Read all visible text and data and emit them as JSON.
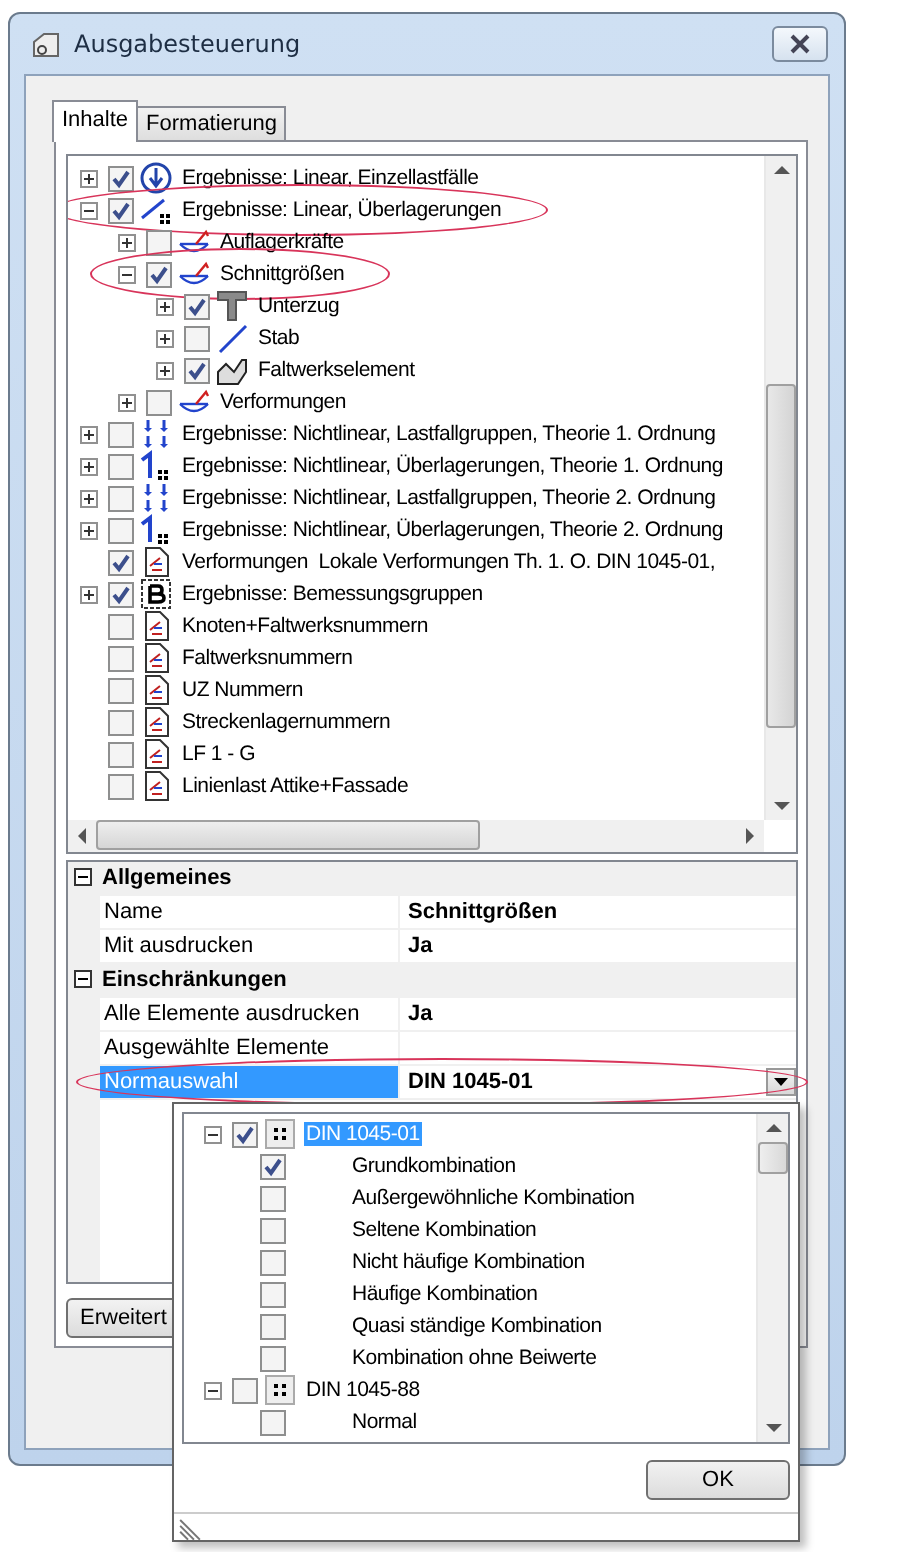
{
  "window": {
    "title": "Ausgabesteuerung"
  },
  "tabs": [
    {
      "label": "Inhalte",
      "selected": true
    },
    {
      "label": "Formatierung",
      "selected": false
    }
  ],
  "tree": {
    "items": [
      {
        "label": "Ergebnisse: Linear, Einzellastfälle",
        "kind": "load-cases",
        "checked": true,
        "expanded": false,
        "circled": false
      },
      {
        "label": "Ergebnisse: Linear, Überlagerungen",
        "kind": "superposition",
        "checked": true,
        "expanded": true,
        "circled": true,
        "children": [
          {
            "label": "Auflagerkräfte",
            "kind": "result",
            "checked": false,
            "expanded": false,
            "circled": false
          },
          {
            "label": "Schnittgrößen",
            "kind": "result",
            "checked": true,
            "expanded": true,
            "circled": true,
            "children": [
              {
                "label": "Unterzug",
                "kind": "t-beam",
                "checked": true,
                "expanded": false,
                "circled": false
              },
              {
                "label": "Stab",
                "kind": "bar",
                "checked": false,
                "expanded": false,
                "circled": false
              },
              {
                "label": "Faltwerkselement",
                "kind": "shell",
                "checked": true,
                "expanded": false,
                "circled": false
              }
            ]
          },
          {
            "label": "Verformungen",
            "kind": "result",
            "checked": false,
            "expanded": false,
            "circled": false
          }
        ]
      },
      {
        "label": "Ergebnisse: Nichtlinear, Lastfallgruppen, Theorie 1. Ordnung",
        "kind": "load-groups",
        "checked": false,
        "expanded": false,
        "circled": false
      },
      {
        "label": "Ergebnisse: Nichtlinear, Überlagerungen, Theorie 1. Ordnung",
        "kind": "nonlinear",
        "checked": false,
        "expanded": false,
        "circled": false
      },
      {
        "label": "Ergebnisse: Nichtlinear, Lastfallgruppen, Theorie 2. Ordnung",
        "kind": "load-groups",
        "checked": false,
        "expanded": false,
        "circled": false
      },
      {
        "label": "Ergebnisse: Nichtlinear, Überlagerungen, Theorie 2. Ordnung",
        "kind": "nonlinear",
        "checked": false,
        "expanded": false,
        "circled": false
      },
      {
        "label": "Verformungen  Lokale Verformungen Th. 1. O. DIN 1045-01,",
        "kind": "document",
        "checked": true,
        "circled": false
      },
      {
        "label": "Ergebnisse: Bemessungsgruppen",
        "kind": "design",
        "checked": true,
        "expanded": false,
        "circled": false
      },
      {
        "label": "Knoten+Faltwerksnummern",
        "kind": "document",
        "checked": false,
        "circled": false
      },
      {
        "label": "Faltwerksnummern",
        "kind": "document",
        "checked": false,
        "circled": false
      },
      {
        "label": "UZ Nummern",
        "kind": "document",
        "checked": false,
        "circled": false
      },
      {
        "label": "Streckenlagernummern",
        "kind": "document",
        "checked": false,
        "circled": false
      },
      {
        "label": "LF 1 - G",
        "kind": "document",
        "checked": false,
        "circled": false
      },
      {
        "label": "Linienlast Attike+Fassade",
        "kind": "document",
        "checked": false,
        "circled": false
      }
    ]
  },
  "properties": {
    "sections": [
      {
        "label": "Allgemeines",
        "expanded": true,
        "rows": [
          {
            "name": "Name",
            "value": "Schnittgrößen",
            "kind": "text",
            "selected": false,
            "circled": false
          },
          {
            "name": "Mit ausdrucken",
            "value": "Ja",
            "kind": "text",
            "selected": false,
            "circled": false
          }
        ]
      },
      {
        "label": "Einschränkungen",
        "expanded": true,
        "rows": [
          {
            "name": "Alle Elemente ausdrucken",
            "value": "Ja",
            "kind": "text",
            "selected": false,
            "circled": false
          },
          {
            "name": "Ausgewählte Elemente",
            "kind": "text",
            "selected": false,
            "circled": false
          },
          {
            "name": "Normauswahl",
            "value": "DIN 1045-01",
            "kind": "dropdown",
            "selected": true,
            "circled": true
          }
        ]
      }
    ]
  },
  "advanced_button": "Erweitert",
  "popup": {
    "items": [
      {
        "label": "DIN 1045-01",
        "checked": true,
        "expanded": true,
        "selected": true,
        "children": [
          {
            "label": "Grundkombination",
            "checked": true,
            "selected": false
          },
          {
            "label": "Außergewöhnliche Kombination",
            "checked": false,
            "selected": false
          },
          {
            "label": "Seltene Kombination",
            "checked": false,
            "selected": false
          },
          {
            "label": "Nicht häufige Kombination",
            "checked": false,
            "selected": false
          },
          {
            "label": "Häufige Kombination",
            "checked": false,
            "selected": false
          },
          {
            "label": "Quasi ständige Kombination",
            "checked": false,
            "selected": false
          },
          {
            "label": "Kombination ohne Beiwerte",
            "checked": false,
            "selected": false
          }
        ]
      },
      {
        "label": "DIN 1045-88",
        "checked": false,
        "expanded": true,
        "selected": false,
        "children": [
          {
            "label": "Normal",
            "checked": false,
            "selected": false
          }
        ]
      }
    ],
    "ok_button": "OK"
  }
}
